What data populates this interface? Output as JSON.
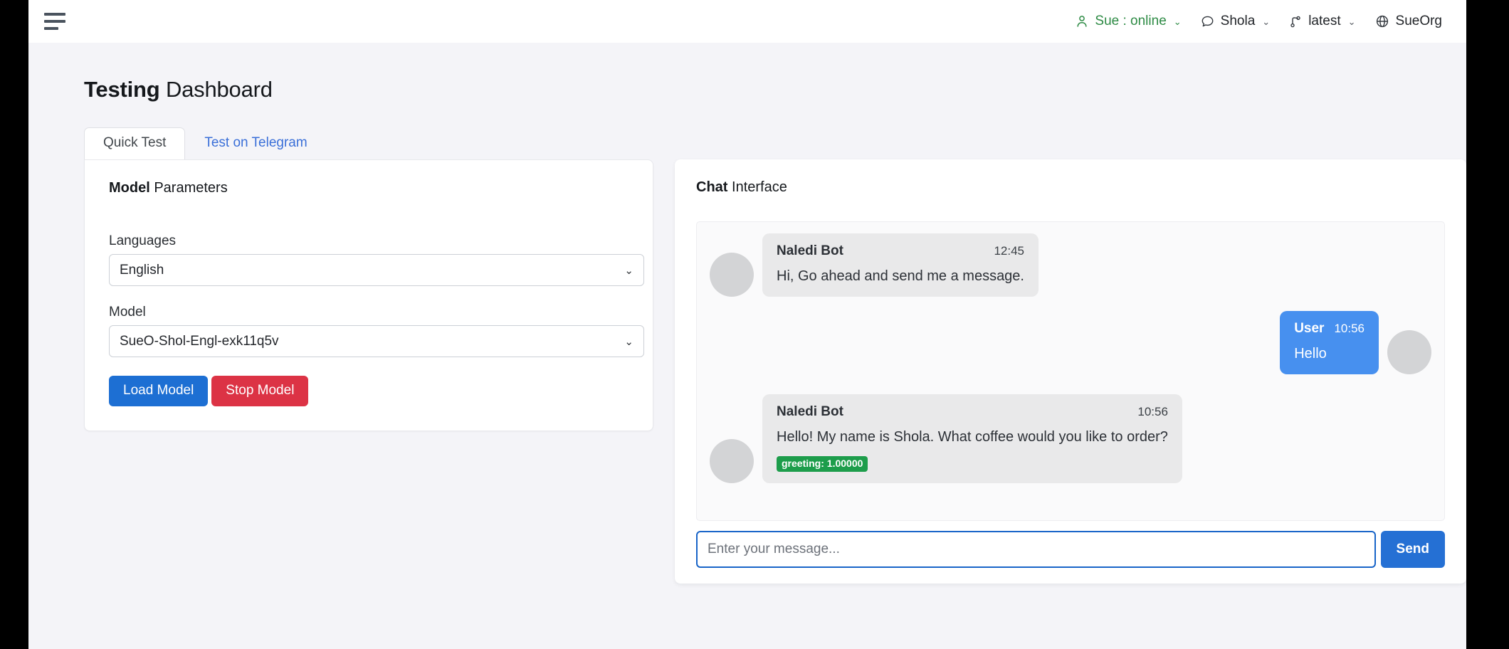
{
  "topbar": {
    "menu_icon": "hamburger-menu-icon",
    "items": [
      {
        "icon": "person-icon",
        "label": "Sue : online",
        "caret": "⌄",
        "has_caret": true,
        "color": "#2e8b45"
      },
      {
        "icon": "chat-bubble-icon",
        "label": "Shola",
        "caret": "⌄",
        "has_caret": true,
        "color": "#222529"
      },
      {
        "icon": "git-branch-icon",
        "label": "latest",
        "caret": "⌄",
        "has_caret": true,
        "color": "#222529"
      },
      {
        "icon": "globe-icon",
        "label": "SueOrg",
        "caret": "",
        "has_caret": false,
        "color": "#222529"
      }
    ]
  },
  "page": {
    "title_strong": "Testing",
    "title_light": " Dashboard"
  },
  "tabs": [
    {
      "label": "Quick Test",
      "active": true
    },
    {
      "label": "Test on Telegram",
      "active": false
    }
  ],
  "model_panel": {
    "title_strong": "Model",
    "title_light": " Parameters",
    "languages_label": "Languages",
    "languages_value": "English",
    "model_label": "Model",
    "model_value": "SueO-Shol-Engl-exk11q5v",
    "caret": "⌄",
    "load_button": "Load Model",
    "stop_button": "Stop Model",
    "load_color": "#1d6fd3",
    "stop_color": "#dc3345"
  },
  "chat_panel": {
    "title_strong": "Chat",
    "title_light": " Interface",
    "messages": [
      {
        "side": "bot",
        "sender": "Naledi Bot",
        "time": "12:45",
        "text": "Hi, Go ahead and send me a message.",
        "badge": null
      },
      {
        "side": "user",
        "sender": "User",
        "time": "10:56",
        "text": "Hello",
        "badge": null
      },
      {
        "side": "bot",
        "sender": "Naledi Bot",
        "time": "10:56",
        "text": "Hello! My name is Shola. What coffee would you like to order?",
        "badge": "greeting: 1.00000"
      }
    ],
    "input_placeholder": "Enter your message...",
    "input_value": "",
    "send_button": "Send",
    "bot_bubble_color": "#e9e9ea",
    "user_bubble_color": "#4790ef",
    "badge_color": "#1d9d4b"
  }
}
